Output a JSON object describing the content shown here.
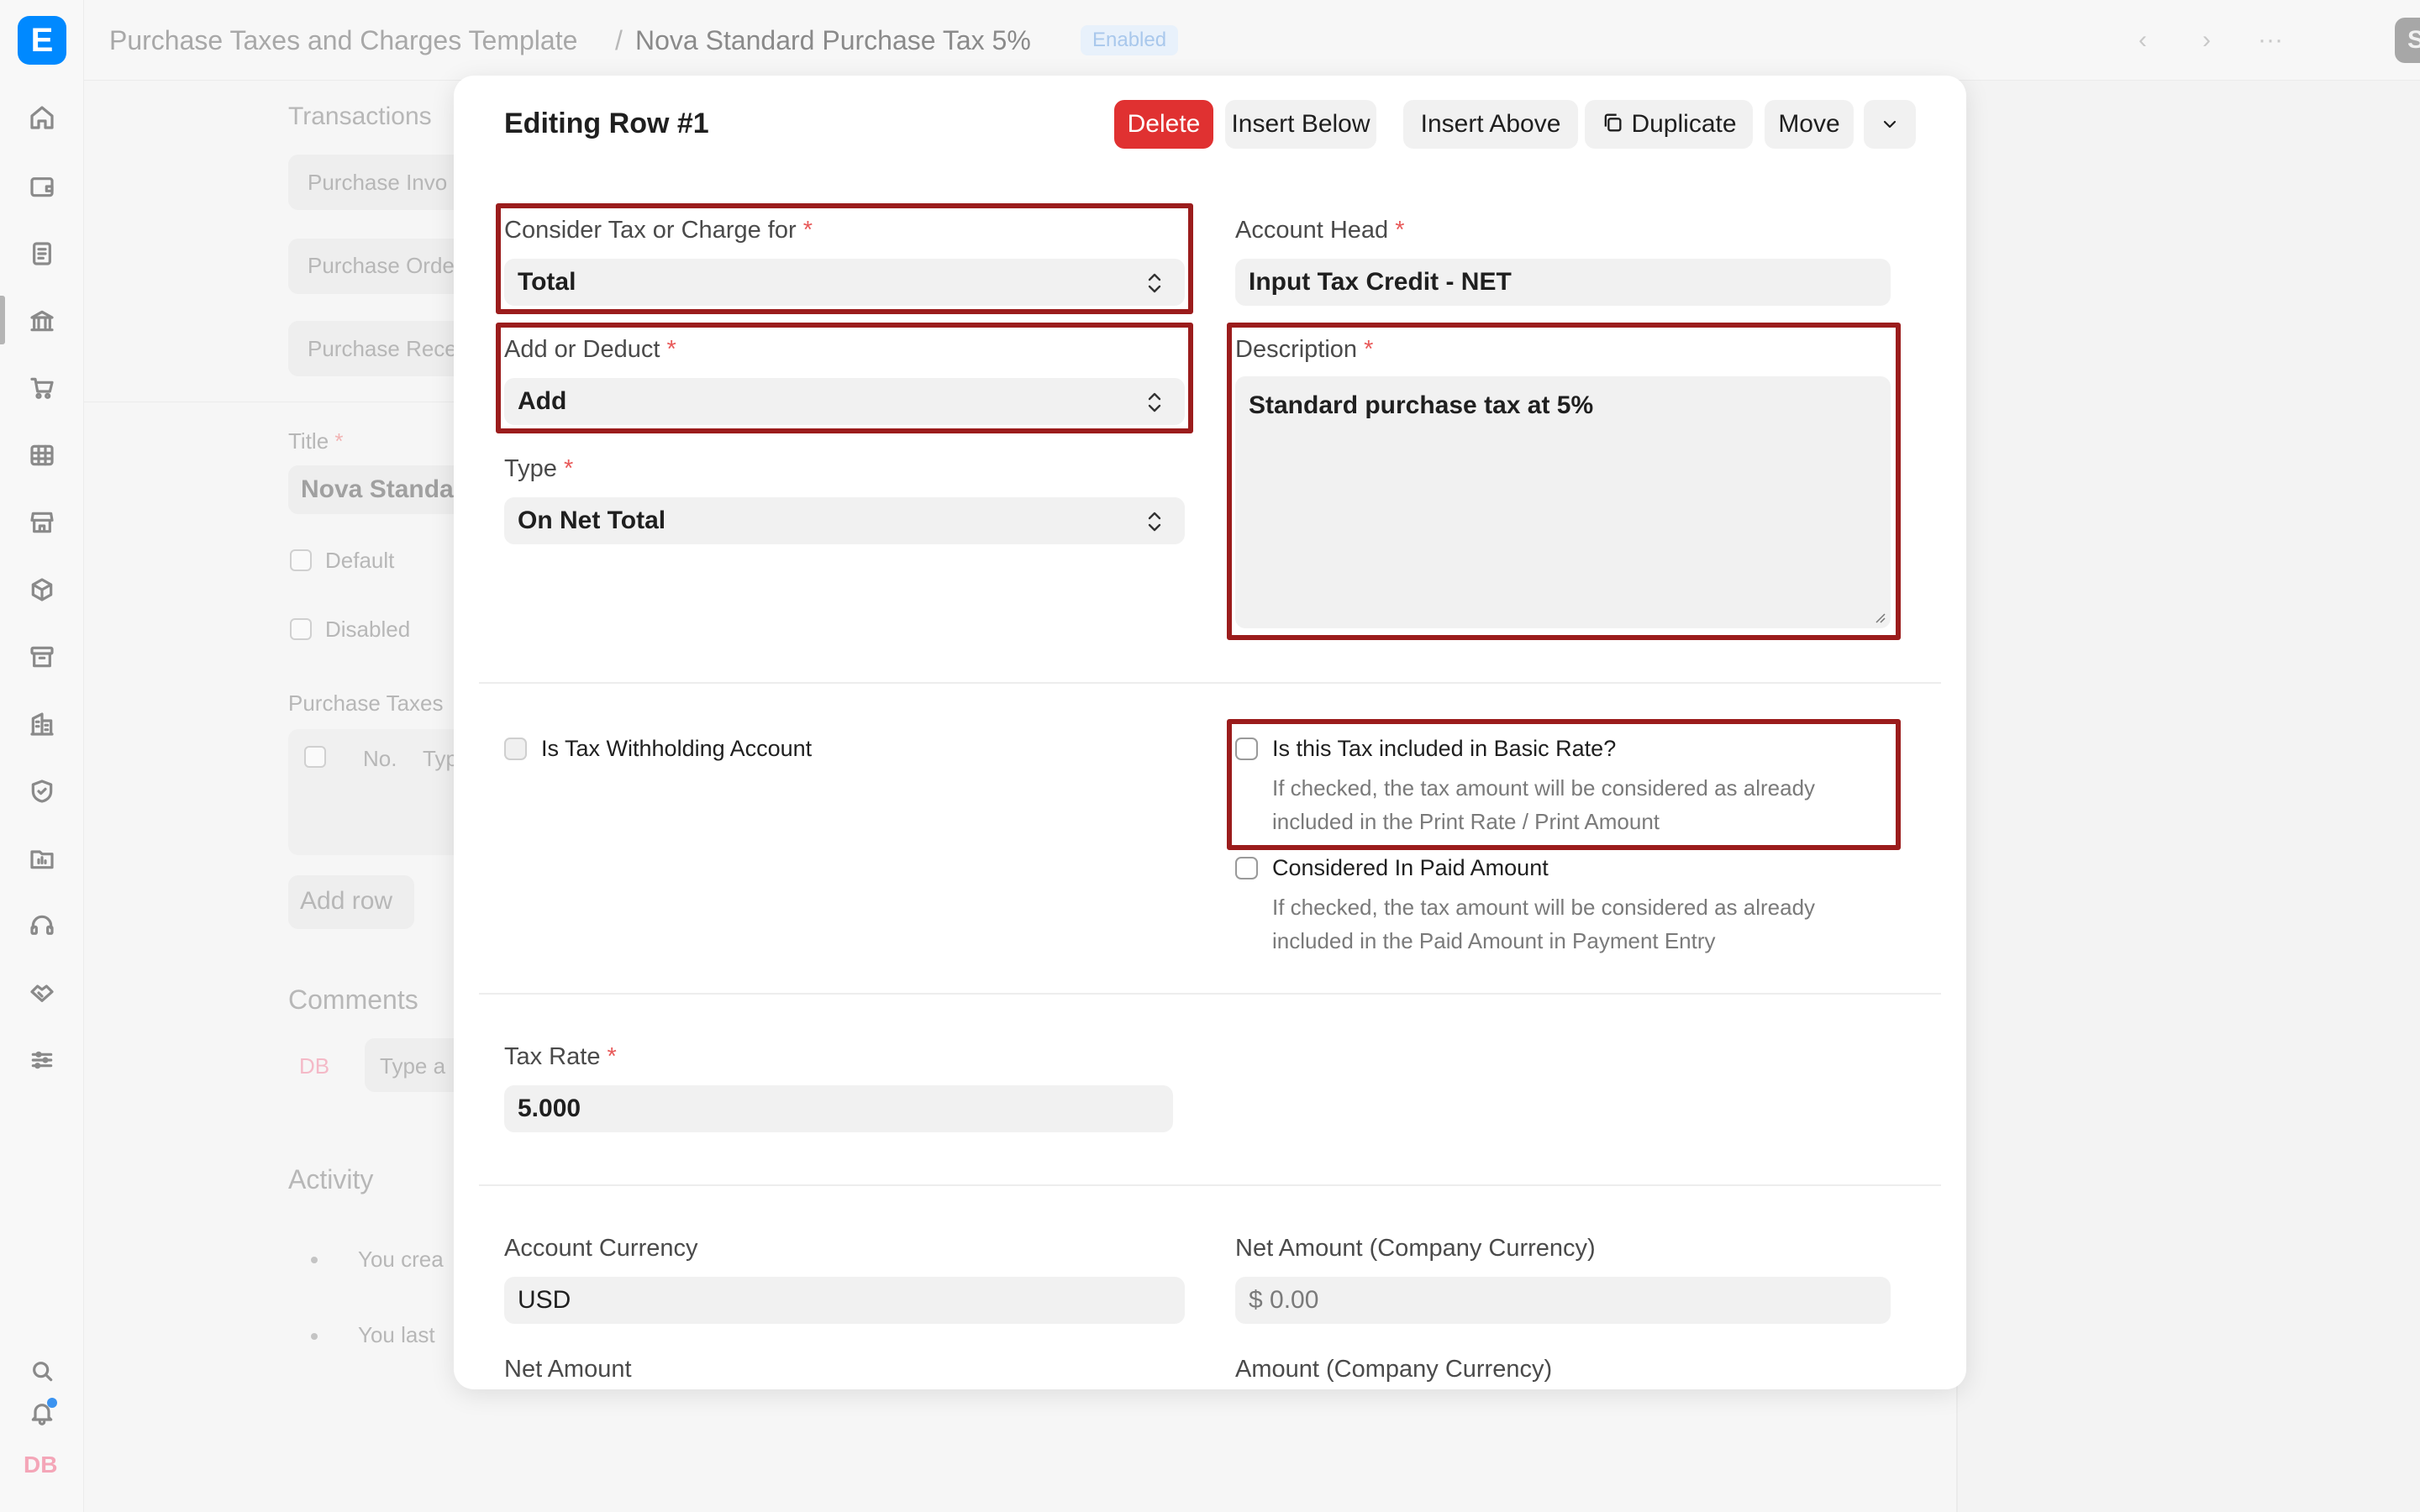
{
  "app": {
    "logo_letter": "E",
    "user_initials": "DB"
  },
  "sidebar": {
    "icons": [
      "home-icon",
      "wallet-icon",
      "document-icon",
      "bank-icon",
      "cart-icon",
      "table-icon",
      "store-icon",
      "package-icon",
      "archive-icon",
      "building-icon",
      "shield-icon",
      "folder-chart-icon",
      "headset-icon",
      "handshake-icon",
      "sliders-icon",
      "search-icon",
      "bell-icon"
    ]
  },
  "topbar": {
    "breadcrumb_parent": "Purchase Taxes and Charges Template",
    "breadcrumb_separator": "/",
    "breadcrumb_current": "Nova Standard Purchase Tax 5%",
    "status": "Enabled",
    "save_label": "Save"
  },
  "background_form": {
    "transactions_heading": "Transactions",
    "transaction_items": [
      "Purchase Invo",
      "Purchase Orde",
      "Purchase Rece"
    ],
    "title_label": "Title",
    "title_value": "Nova Standar",
    "default_label": "Default",
    "disabled_label": "Disabled",
    "taxes_heading": "Purchase Taxes",
    "table_no": "No.",
    "table_type": "Typ",
    "add_row": "Add row",
    "comments_heading": "Comments",
    "comment_avatar": "DB",
    "comment_placeholder": "Type a",
    "activity_heading": "Activity",
    "activity_items": [
      "You crea",
      "You last"
    ]
  },
  "modal": {
    "title": "Editing Row #1",
    "buttons": {
      "delete": "Delete",
      "insert_below": "Insert Below",
      "insert_above": "Insert Above",
      "duplicate": "Duplicate",
      "move": "Move"
    },
    "fields": {
      "consider_tax_label": "Consider Tax or Charge for",
      "consider_tax_value": "Total",
      "add_deduct_label": "Add or Deduct",
      "add_deduct_value": "Add",
      "type_label": "Type",
      "type_value": "On Net Total",
      "account_head_label": "Account Head",
      "account_head_value": "Input Tax Credit - NET",
      "description_label": "Description",
      "description_value": "Standard purchase tax at 5%",
      "withholding_label": "Is Tax Withholding Account",
      "included_label": "Is this Tax included in Basic Rate?",
      "included_help_1": "If checked, the tax amount will be considered as already",
      "included_help_2": "included in the Print Rate / Print Amount",
      "paid_label": "Considered In Paid Amount",
      "paid_help_1": "If checked, the tax amount will be considered as already",
      "paid_help_2": "included in the Paid Amount in Payment Entry",
      "tax_rate_label": "Tax Rate",
      "tax_rate_value": "5.000",
      "account_currency_label": "Account Currency",
      "account_currency_value": "USD",
      "net_amount_company_label": "Net Amount (Company Currency)",
      "net_amount_company_value": "$ 0.00",
      "net_amount_label": "Net Amount",
      "amount_company_label": "Amount (Company Currency)"
    },
    "required_marker": "*"
  },
  "colors": {
    "delete_button": "#e03131",
    "highlight_border": "#9b1c1c",
    "required_asterisk": "#e85a5a",
    "brand": "#0089ff"
  }
}
